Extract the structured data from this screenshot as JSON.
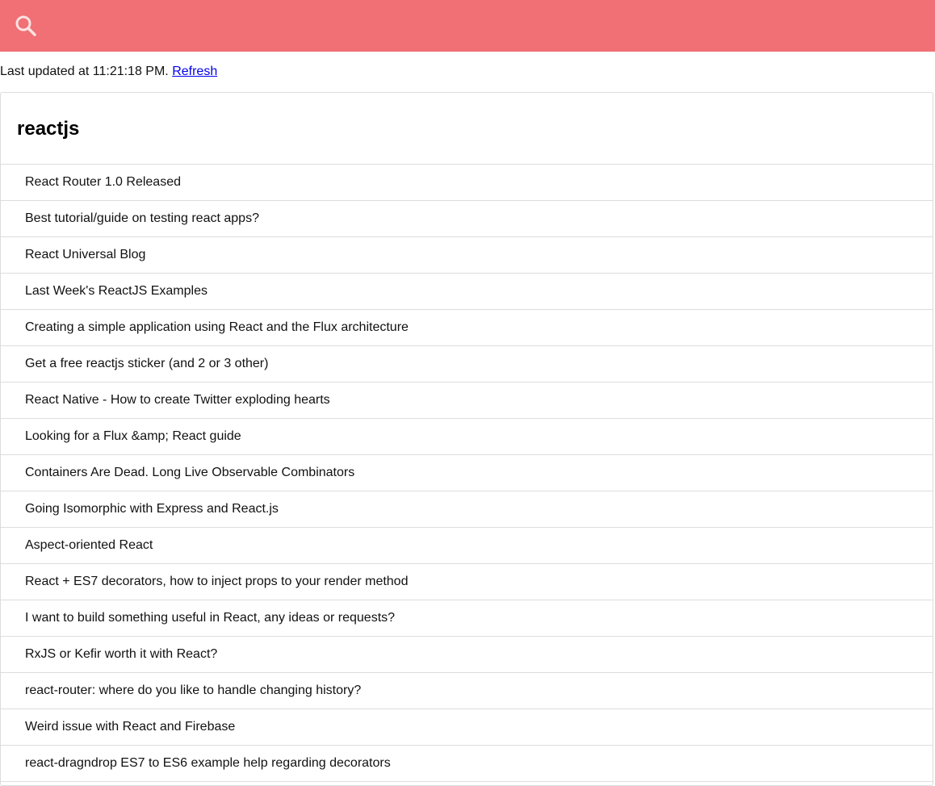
{
  "header": {
    "background_color": "#f07075",
    "search_icon": "search-icon",
    "icon_color": "#fce2e3"
  },
  "status": {
    "prefix": "Last updated at 11:21:18 PM. ",
    "refresh_label": "Refresh"
  },
  "subreddit": {
    "title": "reactjs",
    "posts": [
      {
        "title": "React Router 1.0 Released"
      },
      {
        "title": "Best tutorial/guide on testing react apps?"
      },
      {
        "title": "React Universal Blog"
      },
      {
        "title": "Last Week's ReactJS Examples"
      },
      {
        "title": "Creating a simple application using React and the Flux architecture"
      },
      {
        "title": "Get a free reactjs sticker (and 2 or 3 other)"
      },
      {
        "title": "React Native - How to create Twitter exploding hearts"
      },
      {
        "title": "Looking for a Flux &amp; React guide"
      },
      {
        "title": "Containers Are Dead. Long Live Observable Combinators"
      },
      {
        "title": "Going Isomorphic with Express and React.js"
      },
      {
        "title": "Aspect-oriented React"
      },
      {
        "title": "React + ES7 decorators, how to inject props to your render method"
      },
      {
        "title": "I want to build something useful in React, any ideas or requests?"
      },
      {
        "title": "RxJS or Kefir worth it with React?"
      },
      {
        "title": "react-router: where do you like to handle changing history?"
      },
      {
        "title": "Weird issue with React and Firebase"
      },
      {
        "title": "react-dragndrop ES7 to ES6 example help regarding decorators"
      }
    ]
  }
}
